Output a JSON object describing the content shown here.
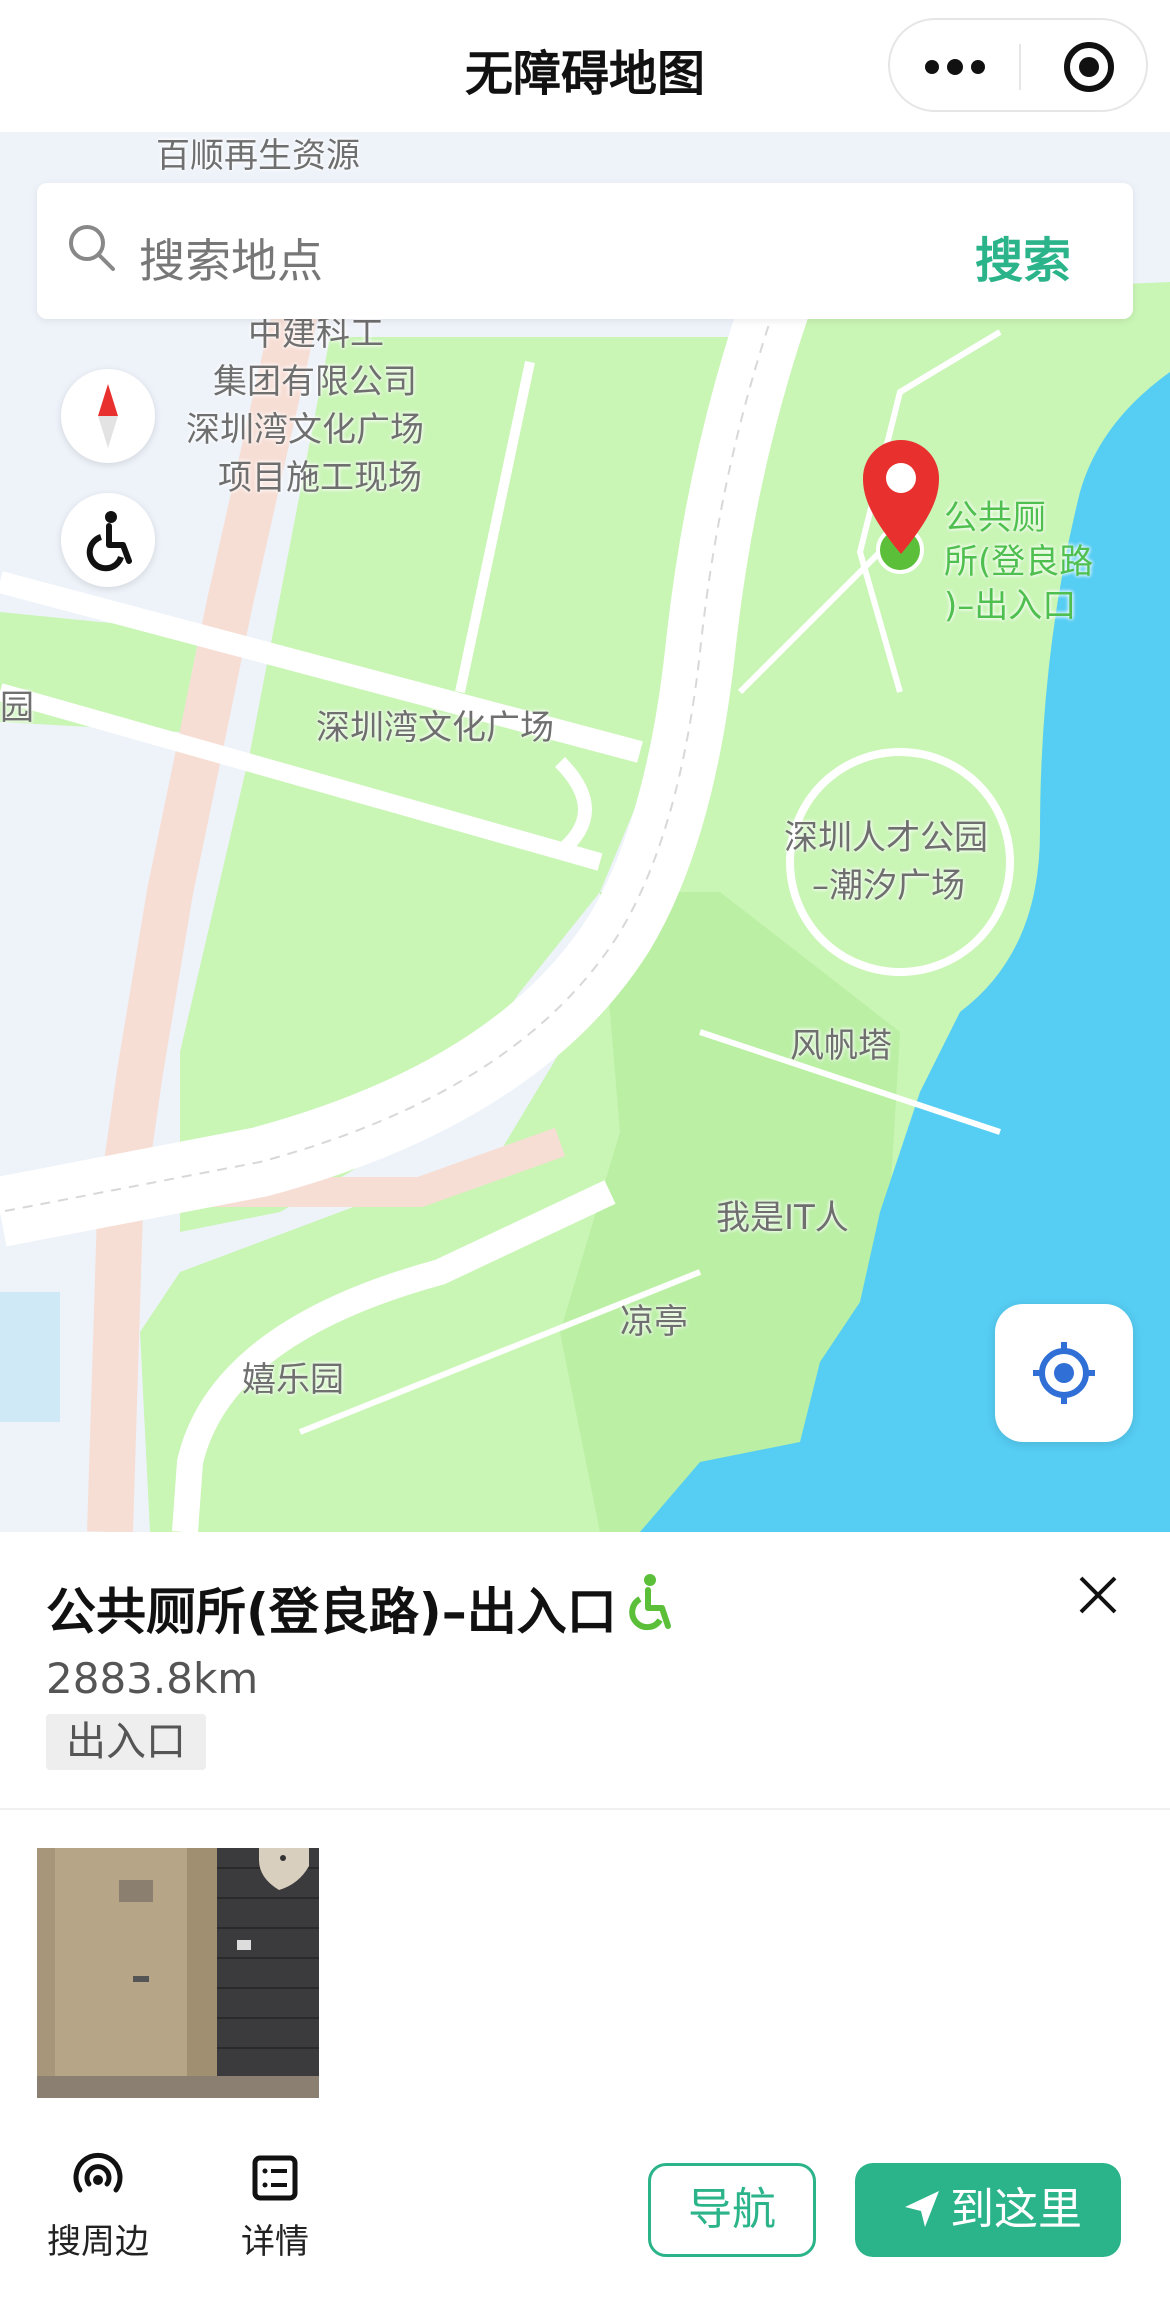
{
  "header": {
    "title": "无障碍地图",
    "more_icon": "more-dots-icon",
    "capsule_icon": "target-circle-icon"
  },
  "search": {
    "placeholder": "搜索地点",
    "button": "搜索"
  },
  "map": {
    "labels": {
      "baishun": "百顺再生资源",
      "zhongjian1": "中建科工",
      "zhongjian2": "集团有限公司",
      "zhongjian3": "深圳湾文化广场",
      "zhongjian4": "项目施工现场",
      "culture_plaza": "深圳湾文化广场",
      "park_left": "园",
      "toilet1": "公共厕",
      "toilet2": "所(登良路",
      "toilet3": ")–出入口",
      "talent_park1": "深圳人才公园",
      "talent_park2": "–潮汐广场",
      "sail_tower": "风帆塔",
      "it_person": "我是IT人",
      "pavilion": "凉亭",
      "xile_garden": "嬉乐园"
    },
    "colors": {
      "water": "#56cdf3",
      "park": "#c9f5b5",
      "land": "#eef3fa",
      "road": "#ffffff",
      "major_road": "#f7ded5",
      "marker": "#e8312f"
    }
  },
  "place": {
    "title": "公共厕所(登良路)–出入口",
    "distance": "2883.8km",
    "tag": "出入口",
    "accent": "#5bbf3a"
  },
  "bottom": {
    "nearby": "搜周边",
    "details": "详情",
    "navigate": "导航",
    "go_here": "到这里",
    "accent": "#2bb38a"
  }
}
